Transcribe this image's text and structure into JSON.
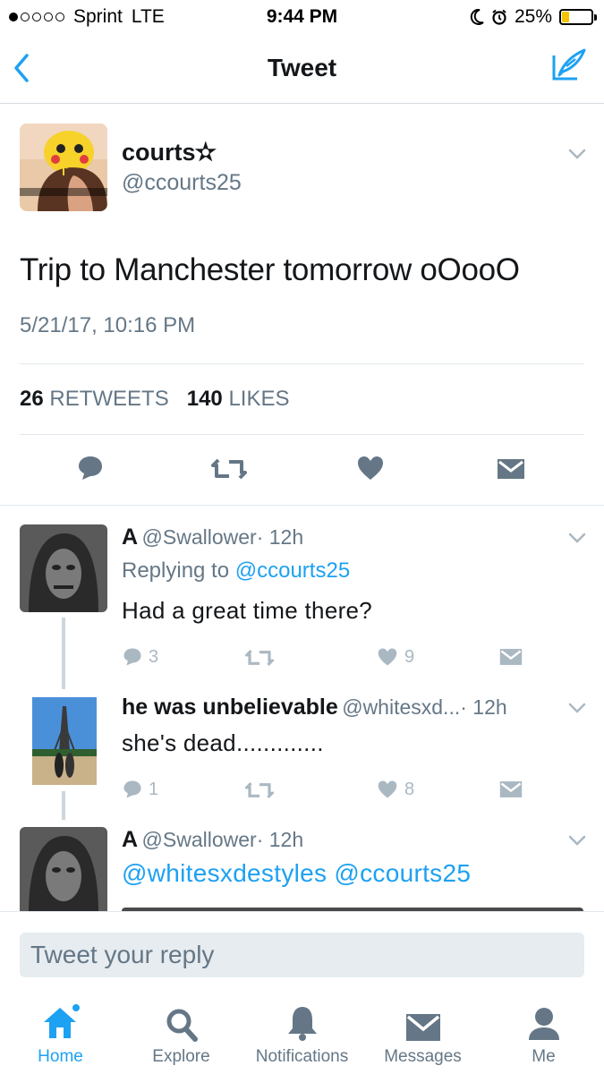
{
  "status_bar": {
    "carrier": "Sprint",
    "network": "LTE",
    "time": "9:44 PM",
    "battery": "25%",
    "battery_level": 0.25
  },
  "nav": {
    "title": "Tweet",
    "back_icon": "chevron-left-icon",
    "compose_icon": "compose-icon"
  },
  "tweet": {
    "author_name": "courts✫",
    "author_handle": "@ccourts25",
    "text": "Trip to Manchester tomorrow oOooO",
    "timestamp": "5/21/17, 10:16 PM",
    "retweets": "26",
    "retweets_label": "RETWEETS",
    "likes": "140",
    "likes_label": "LIKES"
  },
  "replies": [
    {
      "name": "A",
      "handle": "@Swallower",
      "time": "· 12h",
      "replying_prefix": "Replying to",
      "replying_to": "@ccourts25",
      "text": "Had a great time there?",
      "reply_count": "3",
      "like_count": "9"
    },
    {
      "name": "he was unbelievable",
      "handle": "@whitesxd...",
      "time": "· 12h",
      "text": "she's dead.............",
      "reply_count": "1",
      "like_count": "8"
    },
    {
      "name": "A",
      "handle": "@Swallower",
      "time": "· 12h",
      "mention1": "@whitesxdestyles",
      "mention2": "@ccourts25"
    }
  ],
  "reply_box": {
    "placeholder": "Tweet your reply"
  },
  "tabs": [
    {
      "label": "Home",
      "icon": "home-icon",
      "active": true
    },
    {
      "label": "Explore",
      "icon": "search-icon"
    },
    {
      "label": "Notifications",
      "icon": "bell-icon"
    },
    {
      "label": "Messages",
      "icon": "envelope-icon"
    },
    {
      "label": "Me",
      "icon": "person-icon"
    }
  ],
  "colors": {
    "accent": "#1da1f2",
    "text": "#14171a",
    "muted": "#657786",
    "icon_gray": "#657786"
  }
}
